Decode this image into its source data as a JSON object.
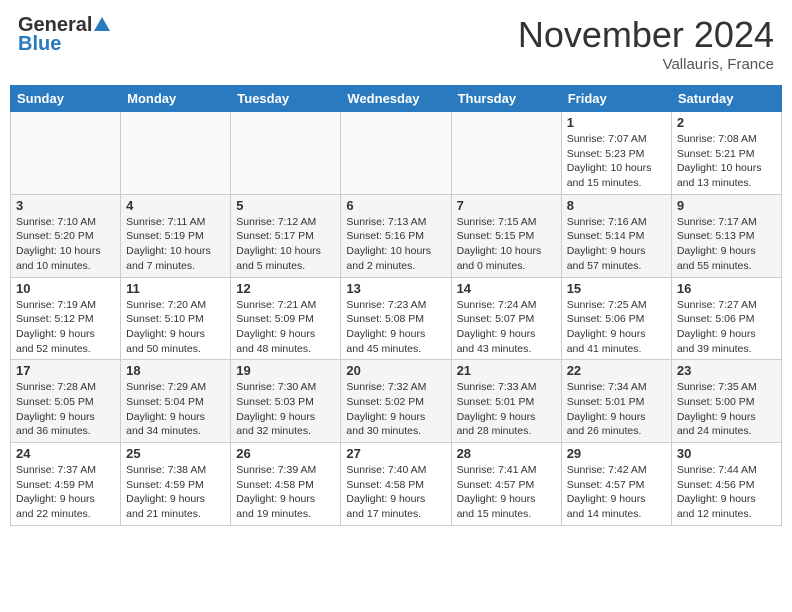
{
  "header": {
    "logo_general": "General",
    "logo_blue": "Blue",
    "month": "November 2024",
    "location": "Vallauris, France"
  },
  "days_of_week": [
    "Sunday",
    "Monday",
    "Tuesday",
    "Wednesday",
    "Thursday",
    "Friday",
    "Saturday"
  ],
  "weeks": [
    [
      {
        "day": "",
        "info": ""
      },
      {
        "day": "",
        "info": ""
      },
      {
        "day": "",
        "info": ""
      },
      {
        "day": "",
        "info": ""
      },
      {
        "day": "",
        "info": ""
      },
      {
        "day": "1",
        "info": "Sunrise: 7:07 AM\nSunset: 5:23 PM\nDaylight: 10 hours and 15 minutes."
      },
      {
        "day": "2",
        "info": "Sunrise: 7:08 AM\nSunset: 5:21 PM\nDaylight: 10 hours and 13 minutes."
      }
    ],
    [
      {
        "day": "3",
        "info": "Sunrise: 7:10 AM\nSunset: 5:20 PM\nDaylight: 10 hours and 10 minutes."
      },
      {
        "day": "4",
        "info": "Sunrise: 7:11 AM\nSunset: 5:19 PM\nDaylight: 10 hours and 7 minutes."
      },
      {
        "day": "5",
        "info": "Sunrise: 7:12 AM\nSunset: 5:17 PM\nDaylight: 10 hours and 5 minutes."
      },
      {
        "day": "6",
        "info": "Sunrise: 7:13 AM\nSunset: 5:16 PM\nDaylight: 10 hours and 2 minutes."
      },
      {
        "day": "7",
        "info": "Sunrise: 7:15 AM\nSunset: 5:15 PM\nDaylight: 10 hours and 0 minutes."
      },
      {
        "day": "8",
        "info": "Sunrise: 7:16 AM\nSunset: 5:14 PM\nDaylight: 9 hours and 57 minutes."
      },
      {
        "day": "9",
        "info": "Sunrise: 7:17 AM\nSunset: 5:13 PM\nDaylight: 9 hours and 55 minutes."
      }
    ],
    [
      {
        "day": "10",
        "info": "Sunrise: 7:19 AM\nSunset: 5:12 PM\nDaylight: 9 hours and 52 minutes."
      },
      {
        "day": "11",
        "info": "Sunrise: 7:20 AM\nSunset: 5:10 PM\nDaylight: 9 hours and 50 minutes."
      },
      {
        "day": "12",
        "info": "Sunrise: 7:21 AM\nSunset: 5:09 PM\nDaylight: 9 hours and 48 minutes."
      },
      {
        "day": "13",
        "info": "Sunrise: 7:23 AM\nSunset: 5:08 PM\nDaylight: 9 hours and 45 minutes."
      },
      {
        "day": "14",
        "info": "Sunrise: 7:24 AM\nSunset: 5:07 PM\nDaylight: 9 hours and 43 minutes."
      },
      {
        "day": "15",
        "info": "Sunrise: 7:25 AM\nSunset: 5:06 PM\nDaylight: 9 hours and 41 minutes."
      },
      {
        "day": "16",
        "info": "Sunrise: 7:27 AM\nSunset: 5:06 PM\nDaylight: 9 hours and 39 minutes."
      }
    ],
    [
      {
        "day": "17",
        "info": "Sunrise: 7:28 AM\nSunset: 5:05 PM\nDaylight: 9 hours and 36 minutes."
      },
      {
        "day": "18",
        "info": "Sunrise: 7:29 AM\nSunset: 5:04 PM\nDaylight: 9 hours and 34 minutes."
      },
      {
        "day": "19",
        "info": "Sunrise: 7:30 AM\nSunset: 5:03 PM\nDaylight: 9 hours and 32 minutes."
      },
      {
        "day": "20",
        "info": "Sunrise: 7:32 AM\nSunset: 5:02 PM\nDaylight: 9 hours and 30 minutes."
      },
      {
        "day": "21",
        "info": "Sunrise: 7:33 AM\nSunset: 5:01 PM\nDaylight: 9 hours and 28 minutes."
      },
      {
        "day": "22",
        "info": "Sunrise: 7:34 AM\nSunset: 5:01 PM\nDaylight: 9 hours and 26 minutes."
      },
      {
        "day": "23",
        "info": "Sunrise: 7:35 AM\nSunset: 5:00 PM\nDaylight: 9 hours and 24 minutes."
      }
    ],
    [
      {
        "day": "24",
        "info": "Sunrise: 7:37 AM\nSunset: 4:59 PM\nDaylight: 9 hours and 22 minutes."
      },
      {
        "day": "25",
        "info": "Sunrise: 7:38 AM\nSunset: 4:59 PM\nDaylight: 9 hours and 21 minutes."
      },
      {
        "day": "26",
        "info": "Sunrise: 7:39 AM\nSunset: 4:58 PM\nDaylight: 9 hours and 19 minutes."
      },
      {
        "day": "27",
        "info": "Sunrise: 7:40 AM\nSunset: 4:58 PM\nDaylight: 9 hours and 17 minutes."
      },
      {
        "day": "28",
        "info": "Sunrise: 7:41 AM\nSunset: 4:57 PM\nDaylight: 9 hours and 15 minutes."
      },
      {
        "day": "29",
        "info": "Sunrise: 7:42 AM\nSunset: 4:57 PM\nDaylight: 9 hours and 14 minutes."
      },
      {
        "day": "30",
        "info": "Sunrise: 7:44 AM\nSunset: 4:56 PM\nDaylight: 9 hours and 12 minutes."
      }
    ]
  ]
}
